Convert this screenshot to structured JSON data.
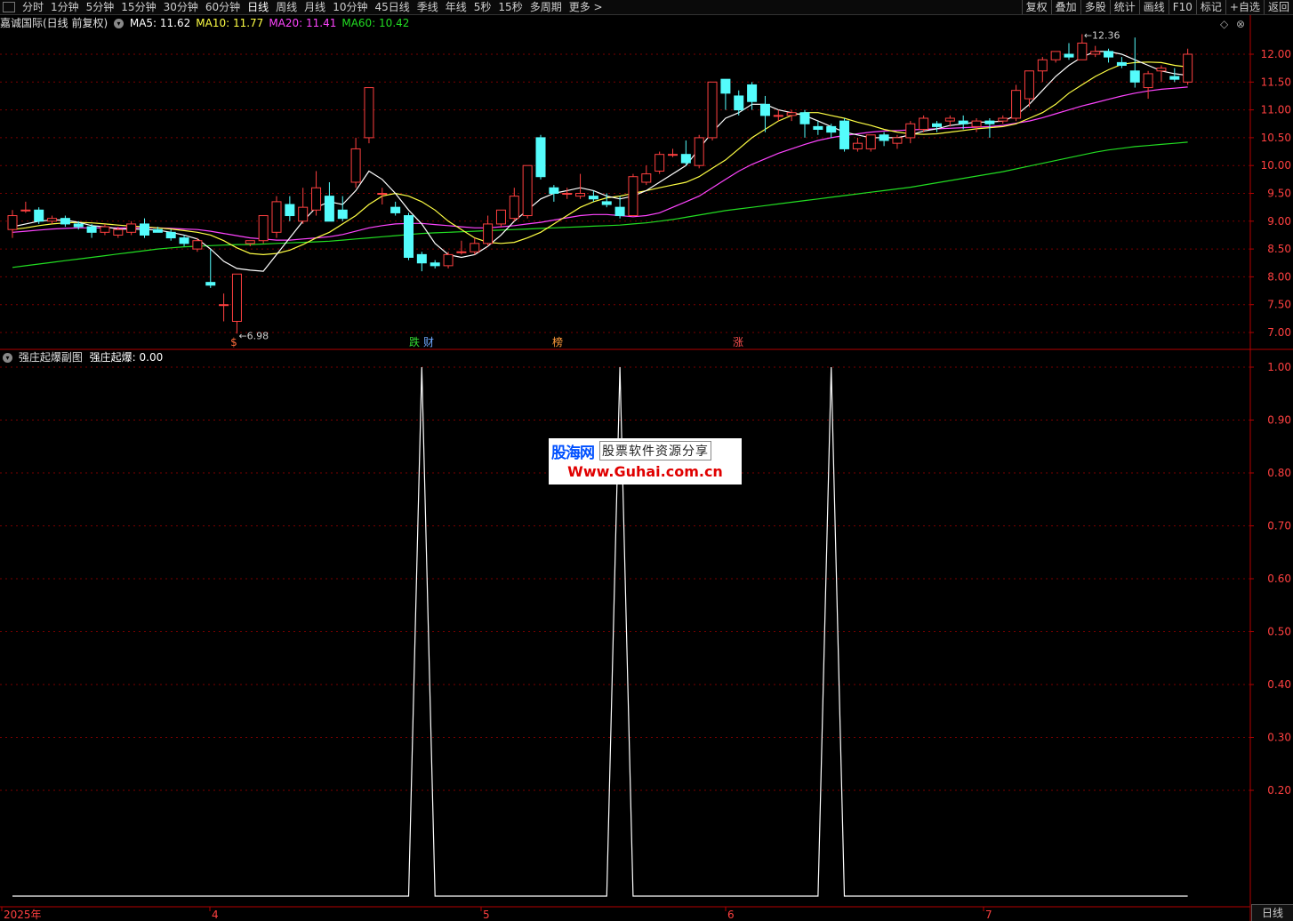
{
  "toolbar": {
    "periods": [
      "分时",
      "1分钟",
      "5分钟",
      "15分钟",
      "30分钟",
      "60分钟",
      "日线",
      "周线",
      "月线",
      "10分钟",
      "45日线",
      "季线",
      "年线",
      "5秒",
      "15秒",
      "多周期",
      "更多 >"
    ],
    "active_period": "日线",
    "right_buttons": [
      "复权",
      "叠加",
      "多股",
      "统计",
      "画线",
      "F10",
      "标记",
      "+自选",
      "返回"
    ]
  },
  "main_chart": {
    "title": "嘉诚国际(日线 前复权)",
    "ma": [
      {
        "label": "MA5: 11.62",
        "color": "#ffffff"
      },
      {
        "label": "MA10: 11.77",
        "color": "#ffff44"
      },
      {
        "label": "MA20: 11.41",
        "color": "#ff44ff"
      },
      {
        "label": "MA60: 10.42",
        "color": "#22dd22"
      }
    ],
    "y_ticks": [
      "12.00",
      "11.50",
      "11.00",
      "10.50",
      "10.00",
      "9.50",
      "9.00",
      "8.50",
      "8.00",
      "7.50",
      "7.00"
    ],
    "high_label": "12.36",
    "low_label": "6.98",
    "markers": [
      {
        "text": "$",
        "color": "#ff6a3a"
      },
      {
        "text": "跌",
        "color": "#33dd33"
      },
      {
        "text": "财",
        "color": "#6ea8ff"
      },
      {
        "text": "榜",
        "color": "#ff9a3a"
      },
      {
        "text": "涨",
        "color": "#ff5050"
      }
    ],
    "controls": [
      "◇",
      "⊗"
    ]
  },
  "sub_chart": {
    "title": "强庄起爆副图",
    "value_label": "强庄起爆: 0.00",
    "y_ticks": [
      "1.00",
      "0.90",
      "0.80",
      "0.70",
      "0.60",
      "0.50",
      "0.40",
      "0.30",
      "0.20"
    ]
  },
  "watermark": {
    "brand": "股海网",
    "slogan": "股票软件资源分享",
    "url": "Www.Guhai.com.cn"
  },
  "x_axis": {
    "labels": [
      "2025年",
      "4",
      "5",
      "6",
      "7"
    ]
  },
  "bottom_tab": "日线",
  "colors": {
    "up": "#ff4040",
    "down": "#54fcfc",
    "grid": "#8b0000",
    "axis": "#b40000"
  },
  "chart_data": [
    {
      "type": "candlestick",
      "ylim": [
        6.9,
        12.3
      ],
      "candles": [
        [
          8.85,
          9.1,
          9.2,
          8.7
        ],
        [
          9.2,
          9.2,
          9.35,
          9.15
        ],
        [
          9.2,
          9.0,
          9.25,
          8.95
        ],
        [
          9.0,
          9.05,
          9.1,
          8.95
        ],
        [
          9.05,
          8.95,
          9.1,
          8.9
        ],
        [
          8.95,
          8.9,
          9.0,
          8.85
        ],
        [
          8.9,
          8.8,
          8.95,
          8.7
        ],
        [
          8.8,
          8.9,
          8.95,
          8.75
        ],
        [
          8.75,
          8.85,
          8.9,
          8.7
        ],
        [
          8.8,
          8.95,
          9.0,
          8.75
        ],
        [
          8.95,
          8.75,
          9.05,
          8.7
        ],
        [
          8.85,
          8.8,
          8.9,
          8.8
        ],
        [
          8.8,
          8.7,
          8.85,
          8.65
        ],
        [
          8.7,
          8.6,
          8.75,
          8.55
        ],
        [
          8.5,
          8.65,
          8.7,
          8.45
        ],
        [
          7.9,
          7.85,
          8.5,
          7.8
        ],
        [
          7.5,
          7.5,
          7.7,
          7.2
        ],
        [
          7.2,
          8.05,
          8.05,
          6.98
        ],
        [
          8.6,
          8.65,
          8.65,
          8.55
        ],
        [
          8.65,
          9.1,
          9.1,
          8.6
        ],
        [
          8.8,
          9.35,
          9.45,
          8.7
        ],
        [
          9.3,
          9.1,
          9.45,
          9.0
        ],
        [
          9.0,
          9.25,
          9.6,
          8.95
        ],
        [
          9.2,
          9.6,
          9.9,
          9.1
        ],
        [
          9.45,
          9.0,
          9.7,
          9.0
        ],
        [
          9.2,
          9.05,
          9.45,
          9.0
        ],
        [
          9.7,
          10.3,
          10.5,
          9.6
        ],
        [
          10.5,
          11.4,
          11.4,
          10.4
        ],
        [
          9.5,
          9.5,
          9.6,
          9.3
        ],
        [
          9.25,
          9.15,
          9.35,
          9.1
        ],
        [
          9.1,
          8.35,
          9.15,
          8.3
        ],
        [
          8.4,
          8.25,
          8.45,
          8.1
        ],
        [
          8.25,
          8.2,
          8.3,
          8.15
        ],
        [
          8.2,
          8.4,
          8.45,
          8.15
        ],
        [
          8.45,
          8.45,
          8.65,
          8.4
        ],
        [
          8.45,
          8.6,
          8.7,
          8.4
        ],
        [
          8.6,
          8.95,
          9.1,
          8.55
        ],
        [
          8.95,
          9.2,
          9.2,
          8.9
        ],
        [
          9.05,
          9.45,
          9.6,
          9.0
        ],
        [
          9.1,
          10.0,
          10.0,
          9.05
        ],
        [
          10.5,
          9.8,
          10.55,
          9.75
        ],
        [
          9.6,
          9.5,
          9.65,
          9.35
        ],
        [
          9.5,
          9.5,
          9.6,
          9.4
        ],
        [
          9.45,
          9.5,
          9.85,
          9.4
        ],
        [
          9.45,
          9.4,
          9.55,
          9.35
        ],
        [
          9.35,
          9.3,
          9.5,
          9.25
        ],
        [
          9.25,
          9.1,
          9.45,
          9.05
        ],
        [
          9.1,
          9.8,
          9.85,
          9.1
        ],
        [
          9.7,
          9.85,
          10.0,
          9.65
        ],
        [
          9.9,
          10.2,
          10.25,
          9.85
        ],
        [
          10.2,
          10.2,
          10.3,
          10.15
        ],
        [
          10.2,
          10.05,
          10.45,
          10.0
        ],
        [
          10.0,
          10.5,
          10.55,
          9.95
        ],
        [
          10.5,
          11.5,
          11.5,
          10.45
        ],
        [
          11.55,
          11.3,
          11.55,
          11.0
        ],
        [
          11.25,
          11.0,
          11.35,
          10.9
        ],
        [
          11.45,
          11.15,
          11.5,
          11.0
        ],
        [
          11.1,
          10.9,
          11.25,
          10.6
        ],
        [
          10.9,
          10.9,
          11.0,
          10.8
        ],
        [
          10.9,
          10.95,
          11.0,
          10.8
        ],
        [
          10.95,
          10.75,
          11.0,
          10.5
        ],
        [
          10.7,
          10.65,
          10.8,
          10.55
        ],
        [
          10.7,
          10.6,
          10.75,
          10.5
        ],
        [
          10.8,
          10.3,
          10.85,
          10.25
        ],
        [
          10.3,
          10.4,
          10.5,
          10.25
        ],
        [
          10.3,
          10.55,
          10.55,
          10.25
        ],
        [
          10.55,
          10.45,
          10.6,
          10.35
        ],
        [
          10.4,
          10.5,
          10.55,
          10.3
        ],
        [
          10.5,
          10.75,
          10.8,
          10.4
        ],
        [
          10.65,
          10.85,
          10.9,
          10.6
        ],
        [
          10.75,
          10.7,
          10.8,
          10.6
        ],
        [
          10.8,
          10.85,
          10.9,
          10.7
        ],
        [
          10.8,
          10.75,
          10.9,
          10.65
        ],
        [
          10.7,
          10.8,
          10.85,
          10.6
        ],
        [
          10.8,
          10.75,
          10.85,
          10.5
        ],
        [
          10.8,
          10.85,
          10.9,
          10.75
        ],
        [
          10.85,
          11.35,
          11.45,
          10.8
        ],
        [
          11.2,
          11.7,
          11.7,
          11.05
        ],
        [
          11.7,
          11.9,
          11.95,
          11.5
        ],
        [
          11.9,
          12.05,
          12.05,
          11.85
        ],
        [
          12.0,
          11.95,
          12.2,
          11.9
        ],
        [
          11.9,
          12.2,
          12.36,
          11.9
        ],
        [
          12.0,
          12.05,
          12.15,
          11.95
        ],
        [
          12.05,
          11.95,
          12.1,
          11.85
        ],
        [
          11.85,
          11.8,
          11.95,
          11.75
        ],
        [
          11.7,
          11.5,
          12.3,
          11.4
        ],
        [
          11.4,
          11.65,
          11.7,
          11.2
        ],
        [
          11.7,
          11.75,
          11.8,
          11.5
        ],
        [
          11.6,
          11.55,
          11.75,
          11.5
        ],
        [
          11.5,
          12.0,
          12.1,
          11.45
        ]
      ],
      "ma5": [
        8.9,
        8.95,
        9.0,
        9.02,
        9.02,
        8.98,
        8.92,
        8.9,
        8.86,
        8.86,
        8.85,
        8.84,
        8.8,
        8.75,
        8.68,
        8.5,
        8.28,
        8.15,
        8.12,
        8.1,
        8.4,
        8.7,
        9.0,
        9.25,
        9.35,
        9.3,
        9.55,
        9.9,
        9.75,
        9.5,
        9.2,
        8.95,
        8.6,
        8.4,
        8.35,
        8.4,
        8.55,
        8.75,
        9.0,
        9.2,
        9.4,
        9.5,
        9.55,
        9.6,
        9.55,
        9.45,
        9.4,
        9.45,
        9.55,
        9.7,
        9.85,
        10.0,
        10.3,
        10.6,
        10.85,
        10.95,
        11.1,
        11.1,
        11.0,
        10.95,
        10.9,
        10.8,
        10.7,
        10.6,
        10.55,
        10.5,
        10.5,
        10.5,
        10.55,
        10.62,
        10.66,
        10.72,
        10.75,
        10.78,
        10.78,
        10.8,
        10.9,
        11.1,
        11.35,
        11.6,
        11.8,
        11.95,
        12.05,
        12.05,
        12.0,
        11.9,
        11.8,
        11.7,
        11.65,
        11.62
      ],
      "ma10": [
        8.85,
        8.88,
        8.92,
        8.95,
        8.97,
        8.98,
        8.97,
        8.95,
        8.93,
        8.91,
        8.9,
        8.88,
        8.86,
        8.83,
        8.8,
        8.75,
        8.65,
        8.52,
        8.42,
        8.4,
        8.42,
        8.48,
        8.58,
        8.7,
        8.8,
        8.95,
        9.1,
        9.3,
        9.45,
        9.5,
        9.45,
        9.35,
        9.2,
        9.0,
        8.85,
        8.7,
        8.62,
        8.6,
        8.62,
        8.7,
        8.8,
        8.95,
        9.1,
        9.25,
        9.35,
        9.42,
        9.45,
        9.5,
        9.55,
        9.6,
        9.65,
        9.7,
        9.8,
        9.95,
        10.1,
        10.3,
        10.5,
        10.65,
        10.8,
        10.9,
        10.95,
        10.95,
        10.9,
        10.85,
        10.78,
        10.72,
        10.65,
        10.6,
        10.57,
        10.56,
        10.57,
        10.6,
        10.63,
        10.66,
        10.68,
        10.7,
        10.75,
        10.85,
        10.95,
        11.1,
        11.3,
        11.45,
        11.6,
        11.72,
        11.82,
        11.85,
        11.86,
        11.85,
        11.8,
        11.77
      ],
      "ma20": [
        8.8,
        8.82,
        8.84,
        8.86,
        8.87,
        8.88,
        8.88,
        8.88,
        8.88,
        8.88,
        8.88,
        8.88,
        8.87,
        8.86,
        8.85,
        8.82,
        8.78,
        8.74,
        8.7,
        8.68,
        8.66,
        8.66,
        8.68,
        8.7,
        8.72,
        8.76,
        8.82,
        8.88,
        8.92,
        8.95,
        8.96,
        8.96,
        8.94,
        8.92,
        8.9,
        8.88,
        8.88,
        8.9,
        8.92,
        8.95,
        8.98,
        9.02,
        9.06,
        9.1,
        9.12,
        9.12,
        9.1,
        9.08,
        9.1,
        9.15,
        9.25,
        9.35,
        9.45,
        9.6,
        9.75,
        9.9,
        10.02,
        10.12,
        10.22,
        10.3,
        10.38,
        10.45,
        10.5,
        10.54,
        10.57,
        10.6,
        10.62,
        10.63,
        10.64,
        10.65,
        10.66,
        10.67,
        10.68,
        10.69,
        10.7,
        10.72,
        10.76,
        10.8,
        10.86,
        10.93,
        11.0,
        11.07,
        11.13,
        11.19,
        11.25,
        11.3,
        11.34,
        11.37,
        11.39,
        11.41
      ],
      "ma60": [
        8.17,
        8.2,
        8.23,
        8.26,
        8.29,
        8.32,
        8.35,
        8.38,
        8.41,
        8.44,
        8.47,
        8.5,
        8.52,
        8.54,
        8.55,
        8.56,
        8.57,
        8.58,
        8.58,
        8.59,
        8.6,
        8.61,
        8.62,
        8.63,
        8.64,
        8.66,
        8.68,
        8.7,
        8.72,
        8.74,
        8.76,
        8.78,
        8.79,
        8.8,
        8.81,
        8.82,
        8.83,
        8.84,
        8.85,
        8.86,
        8.87,
        8.88,
        8.89,
        8.9,
        8.91,
        8.92,
        8.93,
        8.95,
        8.97,
        9.0,
        9.03,
        9.07,
        9.11,
        9.15,
        9.19,
        9.22,
        9.25,
        9.28,
        9.31,
        9.34,
        9.37,
        9.4,
        9.43,
        9.46,
        9.49,
        9.52,
        9.55,
        9.58,
        9.61,
        9.65,
        9.69,
        9.73,
        9.77,
        9.81,
        9.85,
        9.89,
        9.94,
        9.99,
        10.04,
        10.09,
        10.14,
        10.19,
        10.24,
        10.28,
        10.31,
        10.34,
        10.36,
        10.38,
        10.4,
        10.42
      ]
    },
    {
      "type": "line",
      "title": "强庄起爆",
      "ylim": [
        0,
        1.0
      ],
      "spike_indices": [
        31,
        46,
        62
      ],
      "values_rule": "1.00 at spike_indices, 0.00 elsewhere; last value 0.00"
    }
  ]
}
